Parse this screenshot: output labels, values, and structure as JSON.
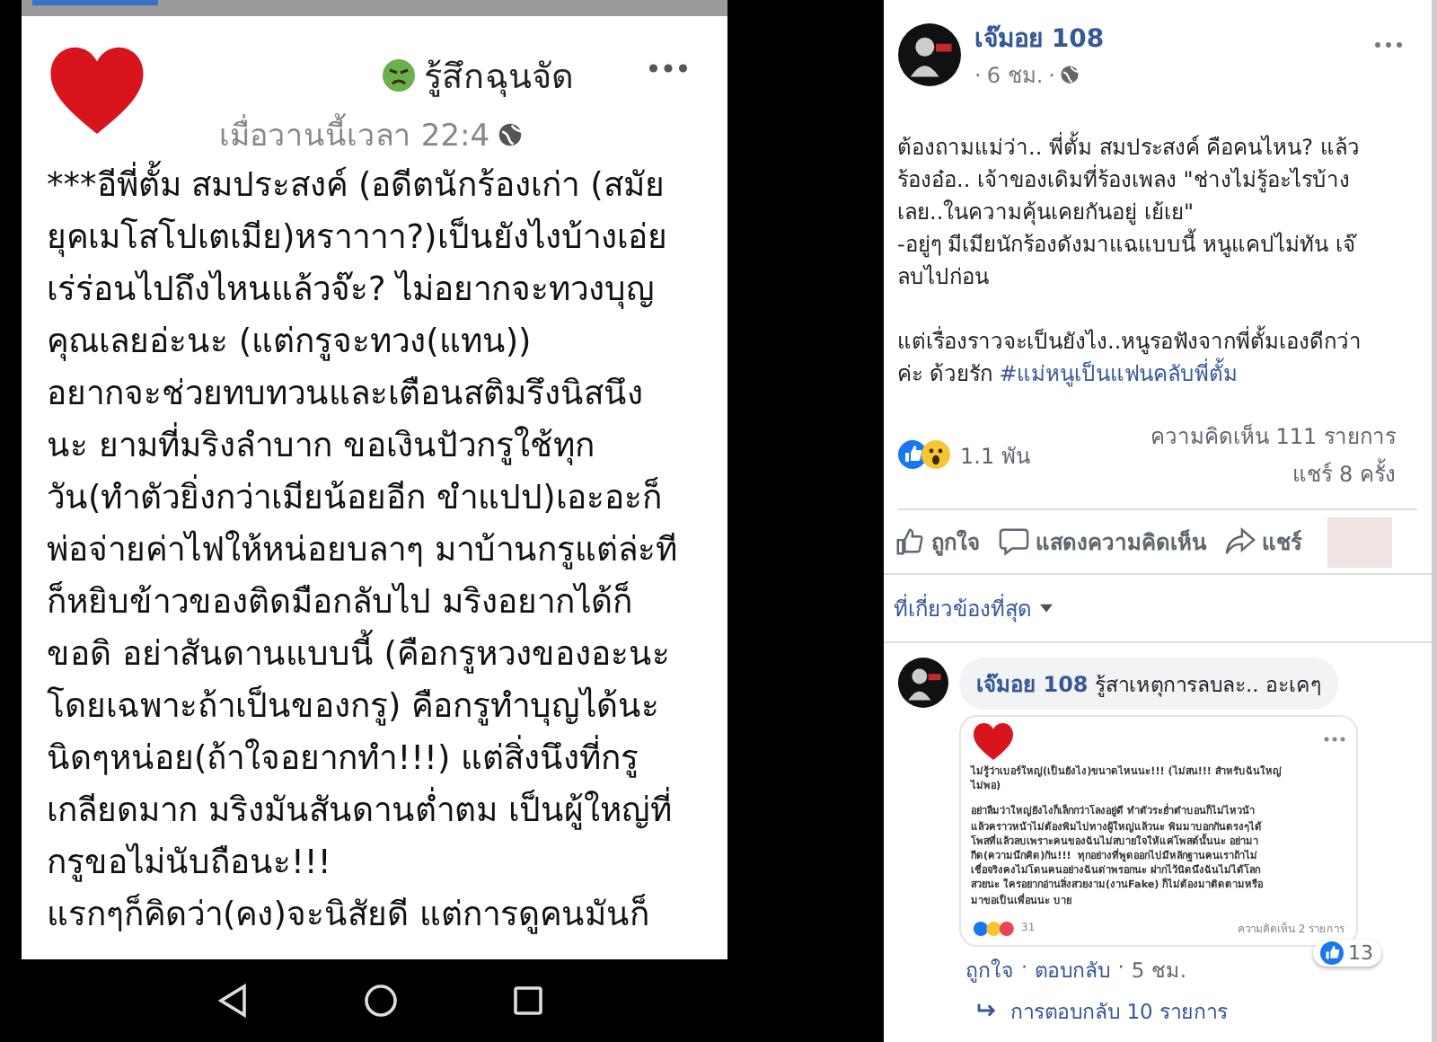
{
  "phone_post": {
    "feeling": "รู้สึกฉุนจัด",
    "time": "เมื่อวานนี้เวลา 22:4",
    "paragraphs": [
      "***อีพี่ตั้ม สมประสงค์ (อดีตนักร้องเก่า (สมัย\nยุคเมโสโปเตเมีย)หราาาา?)เป็นยังไงบ้างเอ่ย\nเร่ร่อนไปถึงไหนแล้วจ๊ะ? ไม่อยากจะทวงบุญ\nคุณเลยอ่ะนะ (แต่กรูจะทวง(แทน))\nอยากจะช่วยทบทวนและเตือนสติมรึงนิสนึง\nนะ ยามที่มริงลำบาก ขอเงินปัวกรูใช้ทุก\nวัน(ทำตัวยิ่งกว่าเมียน้อยอีก ขำแปป)เอะอะก็\nพ่อจ่ายค่าไฟให้หน่อยบลาๆ มาบ้านกรูแต่ล่ะที\nก็หยิบข้าวของติดมือกลับไป มริงอยากได้ก็\nขอดิ อย่าสันดานแบบนี้ (คือกรูหวงของอะนะ\nโดยเฉพาะถ้าเป็นของกรู) คือกรูทำบุญได้นะ\nนิดๆหน่อย(ถ้าใจอยากทำ!!!) แต่สิ่งนึงที่กรู\nเกลียดมาก มริงมันสันดานต่ำตม เป็นผู้ใหญ่ที่\nกรูขอไม่นับถือนะ!!!",
      "แรกๆก็คิดว่า(คง)จะนิสัยดี แต่การดูคนมันก็"
    ]
  },
  "post": {
    "author": "เจ๊มอย 108",
    "separator": "·",
    "time": "6 ชม.",
    "paragraphs": [
      "ต้องถามแม่ว่า.. พี่ตั้ม สมประสงค์ คือคนไหน? แล้ว\nร้องอ๋อ.. เจ้าของเดิมที่ร้องเพลง \"ช่างไม่รู้อะไรบ้าง\nเลย..ในความคุ้นเคยกันอยู่ เย้เย\"\n-อยู่ๆ มีเมียนักร้องดังมาแฉแบบนี้ หนูแคปไม่ทัน เจ๊\nลบไปก่อน",
      "แต่เรื่องราวจะเป็นยังไง..หนูรอฟังจากพี่ตั้มเองดีกว่า\nค่ะ ด้วยรัก "
    ],
    "hashtag": "#แม่หนูเป็นแฟนคลับพี่ตั้ม",
    "reaction_count": "1.1 พัน",
    "comments": "ความคิดเห็น 111 รายการ",
    "shares": "แชร์ 8 ครั้ง",
    "actions": [
      {
        "kind": "like",
        "label": "ถูกใจ"
      },
      {
        "kind": "comment",
        "label": "แสดงความคิดเห็น"
      },
      {
        "kind": "share",
        "label": "แชร์"
      }
    ]
  },
  "sort": "ที่เกี่ยวข้องที่สุด",
  "comment": {
    "author": "เจ๊มอย 108",
    "text": "รู้สาเหตุการลบละ.. อะเคๆ",
    "screenshot": {
      "paragraphs": [
        "ไม่รู้ว่าเบอร์ใหญ่(เป็นยังไง)ขนาดไหนนะ!!! (ไม่สน!!! สำหรับฉันใหญ่\nไม่พอ)",
        "อย่าลืมว่าใหญ่ยังไงก็เล็กกว่าโลงอยู่ดี ทำตัวระย่ำตำบอนก็ไม่ไหวน้า\nแล้วคราวหน้าไม่ต้องพิมไปทางผู้ใหญ่แล้วนะ พิมมาบอกกันตรงๆได้\nโพสที่แล้วลบเพราะคนของฉันไม่สบายใจให้แค่โพสต์นั้นนะ อย่ามา\nกีด(ความนึกคิด)กัน!!!  ทุกอย่างที่พูดออกไปมีหลักฐานคนเราถ้าไม่\nเชื่อจริงคงไม่โดนคนอย่างฉันด่าพรอกนะ ฝากไว้นิดนึงฉันไม่ได้โลก\nสวยนะ ใครอยากอ่านสิ่งสวยงาม(งานFake) ก็ไม่ต้องมาติดตามหรือ\nมาขอเป็นเพื่อนนะ บาย"
      ],
      "reaction_count": "31",
      "comments": "ความคิดเห็น 2 รายการ"
    },
    "like_count": "13",
    "actions": [
      "ถูกใจ",
      "ตอบกลับ"
    ],
    "separator": "·",
    "time": "5 ชม.",
    "replies": "การตอบกลับ 10 รายการ"
  }
}
